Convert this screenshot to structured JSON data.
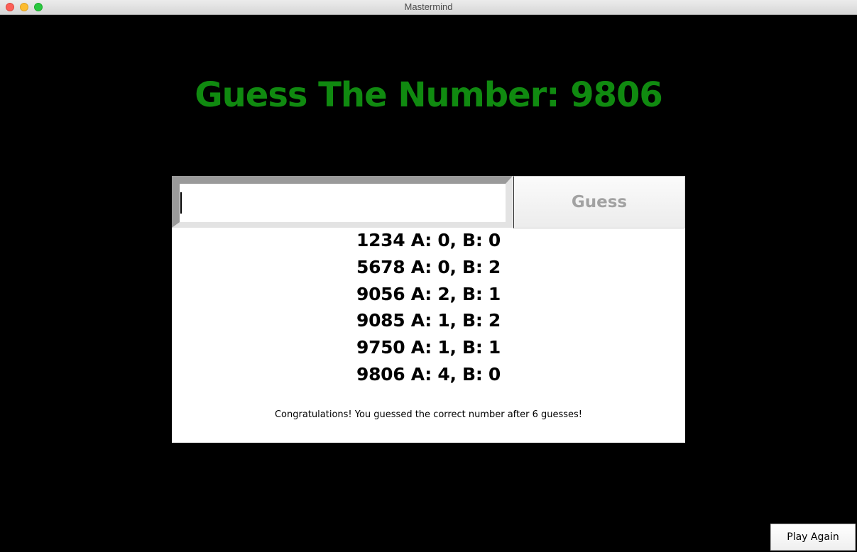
{
  "window": {
    "title": "Mastermind"
  },
  "heading": {
    "text": "Guess The Number: 9806"
  },
  "guess_input": {
    "value": "",
    "placeholder": ""
  },
  "guess_button": {
    "label": "Guess"
  },
  "history": [
    "1234 A: 0, B: 0",
    "5678 A: 0, B: 2",
    "9056 A: 2, B: 1",
    "9085 A: 1, B: 2",
    "9750 A: 1, B: 1",
    "9806 A: 4, B: 0"
  ],
  "message": "Congratulations! You guessed the correct number after 6 guesses!",
  "play_again": {
    "label": "Play Again"
  },
  "colors": {
    "background": "#000000",
    "heading": "#108a10",
    "panel": "#ffffff",
    "button_text_disabled": "#a2a2a2"
  }
}
